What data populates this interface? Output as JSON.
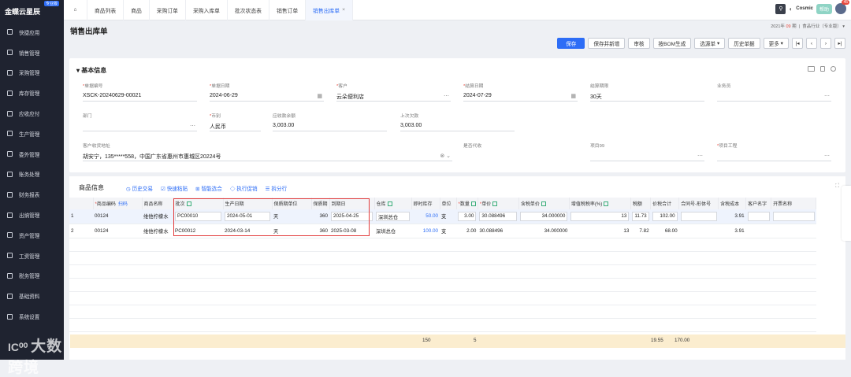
{
  "app": {
    "brand": "金蝶云星辰",
    "edition": "专业版"
  },
  "sidebar": [
    {
      "label": "快捷应用",
      "icon": "grid-icon"
    },
    {
      "label": "销售管理",
      "icon": "chart-icon"
    },
    {
      "label": "采购管理",
      "icon": "cart-icon"
    },
    {
      "label": "库存管理",
      "icon": "box-icon"
    },
    {
      "label": "应收应付",
      "icon": "coin-icon"
    },
    {
      "label": "生产管理",
      "icon": "factory-icon"
    },
    {
      "label": "委外管理",
      "icon": "truck-icon"
    },
    {
      "label": "账务处理",
      "icon": "ledger-icon"
    },
    {
      "label": "财务报表",
      "icon": "report-icon"
    },
    {
      "label": "出纳管理",
      "icon": "wallet-icon"
    },
    {
      "label": "资产管理",
      "icon": "asset-icon"
    },
    {
      "label": "工资管理",
      "icon": "salary-icon"
    },
    {
      "label": "税务管理",
      "icon": "tax-icon"
    },
    {
      "label": "基础资料",
      "icon": "gear-icon"
    },
    {
      "label": "系统设置",
      "icon": "settings-icon"
    }
  ],
  "watermark": "大数跨境",
  "tabs": [
    "商品列表",
    "商品",
    "采购订单",
    "采购入库单",
    "批次状态表",
    "销售订单",
    "销售出库单"
  ],
  "topright": {
    "org": "Cosmic",
    "help": "帮助",
    "notify": "45",
    "period_year": "2021年",
    "period_no": "09",
    "period_unit": "期",
    "industry": "食品行业（专业版）"
  },
  "page": {
    "title": "销售出库单"
  },
  "toolbar": [
    "保存",
    "保存并新增",
    "审核",
    "按BOM生成",
    "选源单",
    "历史单据",
    "更多"
  ],
  "form": {
    "section": "基本信息",
    "bill_no_label": "单据编号",
    "bill_no": "XSCK-20240629-00021",
    "date_label": "单据日期",
    "date": "2024-06-29",
    "customer_label": "客户",
    "customer": "云朵便利店",
    "settle_date_label": "结算日期",
    "settle_date": "2024-07-29",
    "settle_term_label": "结算期限",
    "settle_term": "30天",
    "salesman_label": "业务员",
    "salesman": "",
    "dept_label": "部门",
    "dept": "",
    "currency_label": "币别",
    "currency": "人民币",
    "receivable_label": "应收款余额",
    "receivable": "3,003.00",
    "last_debt_label": "上次欠款",
    "last_debt": "3,003.00",
    "address_label": "客户收货地址",
    "address": "胡安宁，135*****558，中国广东省惠州市惠城区20224号",
    "agent_label": "是否代收",
    "project99_label": "项目99",
    "project_label": "项目工程"
  },
  "items": {
    "section": "商品信息",
    "links": [
      "历史交易",
      "快速粘贴",
      "智能选合",
      "执行促销",
      "拆分行"
    ],
    "scan_label": "扫码",
    "columns": [
      "",
      "商品编码",
      "商品名称",
      "批次",
      "生产日期",
      "保质期单位",
      "保质期",
      "到期日",
      "仓库",
      "即时库存",
      "单位",
      "数量",
      "单价",
      "含税单价",
      "增值税税率(%)",
      "税额",
      "价税合计",
      "合同号-形体号",
      "含税成本",
      "客户名字",
      "开票名称"
    ],
    "rows": [
      [
        "1",
        "00124",
        "维他柠檬水",
        "PC00010",
        "2024-05-01",
        "天",
        "360",
        "2025-04-25",
        "深圳总仓",
        "50.00",
        "支",
        "3.00",
        "30.088496",
        "34.000000",
        "13",
        "11.73",
        "102.00",
        "",
        "3.91",
        "",
        ""
      ],
      [
        "2",
        "00124",
        "维他柠檬水",
        "PC00012",
        "2024-03-14",
        "天",
        "360",
        "2025-03-08",
        "深圳总仓",
        "100.00",
        "支",
        "2.00",
        "30.088496",
        "34.000000",
        "13",
        "7.82",
        "68.00",
        "",
        "3.91",
        "",
        ""
      ]
    ],
    "totals": {
      "stock": "150",
      "qty": "5",
      "tax": "19.55",
      "total": "170.00"
    }
  }
}
